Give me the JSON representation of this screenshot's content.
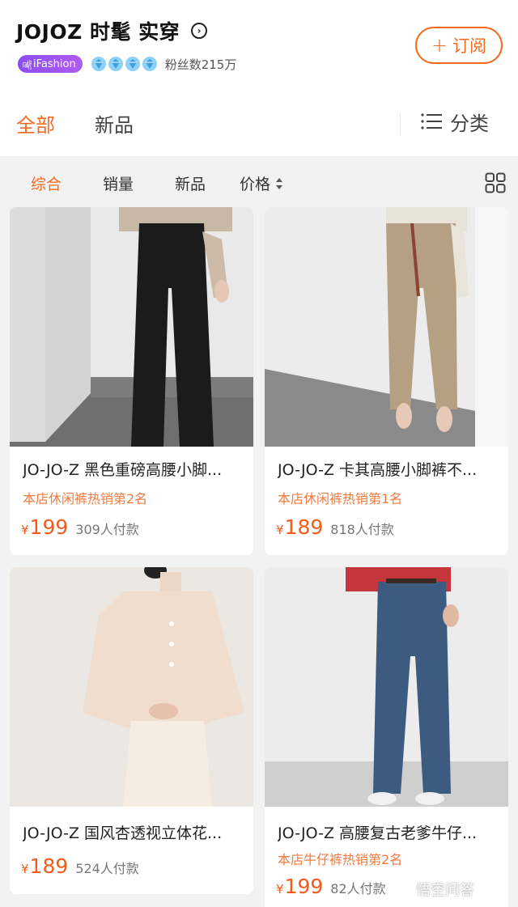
{
  "store": {
    "name": "JOJOZ 时髦 实穿",
    "badge": "iFashion",
    "badge_glyph": "㎯",
    "fans": "粉丝数215万",
    "diamond_count": 4,
    "subscribe_plus": "+",
    "subscribe_label": "订阅",
    "info_glyph": "›"
  },
  "tabs": {
    "items": [
      {
        "label": "全部",
        "active": true
      },
      {
        "label": "新品",
        "active": false
      }
    ],
    "category_label": "分类"
  },
  "sort": {
    "items": [
      {
        "label": "综合",
        "active": true
      },
      {
        "label": "销量",
        "active": false
      },
      {
        "label": "新品",
        "active": false
      },
      {
        "label": "价格",
        "active": false
      }
    ]
  },
  "products": [
    {
      "title": "JO-JO-Z 黑色重磅高腰小脚...",
      "rank": "本店休闲裤热销第2名",
      "currency": "¥",
      "price": "199",
      "paid": "309人付款",
      "image": "black-trousers"
    },
    {
      "title": "JO-JO-Z 卡其高腰小脚裤不...",
      "rank": "本店休闲裤热销第1名",
      "currency": "¥",
      "price": "189",
      "paid": "818人付款",
      "image": "khaki-trousers"
    },
    {
      "title": "JO-JO-Z 国风杏透视立体花...",
      "rank": "",
      "currency": "¥",
      "price": "189",
      "paid": "524人付款",
      "image": "apricot-blouse"
    },
    {
      "title": "JO-JO-Z 高腰复古老爹牛仔...",
      "rank": "本店牛仔裤热销第2名",
      "currency": "¥",
      "price": "199",
      "paid": "82人付款",
      "image": "dad-jeans"
    }
  ],
  "watermark": "悟空问答",
  "colors": {
    "accent": "#f36b21",
    "price": "#f35a1c",
    "rank": "#f07b3f",
    "badge": "#9650f1"
  }
}
